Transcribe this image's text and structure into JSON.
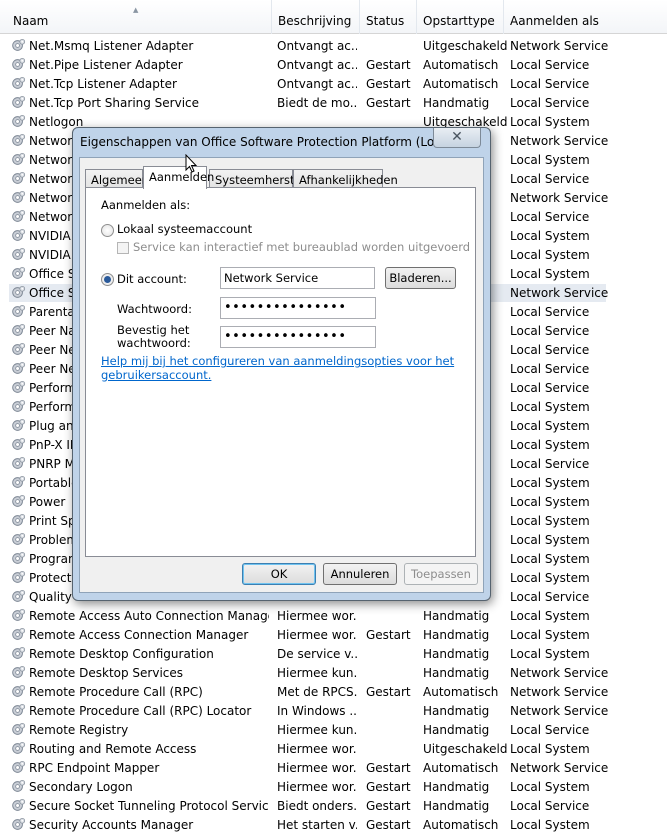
{
  "columns": {
    "name": "Naam",
    "description": "Beschrijving",
    "status": "Status",
    "startup": "Opstarttype",
    "logon": "Aanmelden als"
  },
  "services": [
    {
      "name": "Net.Msmq Listener Adapter",
      "desc": "Ontvangt ac...",
      "status": "",
      "start": "Uitgeschakeld",
      "logon": "Network Service"
    },
    {
      "name": "Net.Pipe Listener Adapter",
      "desc": "Ontvangt ac...",
      "status": "Gestart",
      "start": "Automatisch",
      "logon": "Local Service"
    },
    {
      "name": "Net.Tcp Listener Adapter",
      "desc": "Ontvangt ac...",
      "status": "Gestart",
      "start": "Automatisch",
      "logon": "Local Service"
    },
    {
      "name": "Net.Tcp Port Sharing Service",
      "desc": "Biedt de mo...",
      "status": "Gestart",
      "start": "Handmatig",
      "logon": "Local Service"
    },
    {
      "name": "Netlogon",
      "desc": "",
      "status": "",
      "start": "Uitgeschakeld",
      "logon": "Local System"
    },
    {
      "name": "Network",
      "desc": "",
      "status": "",
      "start": "",
      "logon": "Network Service"
    },
    {
      "name": "Network",
      "desc": "",
      "status": "",
      "start": "",
      "logon": "Local System"
    },
    {
      "name": "Network",
      "desc": "",
      "status": "",
      "start": "",
      "logon": "Local Service"
    },
    {
      "name": "Network",
      "desc": "",
      "status": "",
      "start": "",
      "logon": "Network Service"
    },
    {
      "name": "Network",
      "desc": "",
      "status": "",
      "start": "",
      "logon": "Local Service"
    },
    {
      "name": "NVIDIA",
      "desc": "",
      "status": "",
      "start": "",
      "logon": "Local System"
    },
    {
      "name": "NVIDIA",
      "desc": "",
      "status": "",
      "start": "",
      "logon": "Local System"
    },
    {
      "name": "Office S",
      "desc": "",
      "status": "",
      "start": "",
      "logon": "Local System"
    },
    {
      "name": "Office S",
      "desc": "",
      "status": "",
      "start": "",
      "logon": "Network Service",
      "selected": true
    },
    {
      "name": "Parental",
      "desc": "",
      "status": "",
      "start": "",
      "logon": "Local Service"
    },
    {
      "name": "Peer Na",
      "desc": "",
      "status": "",
      "start": "",
      "logon": "Local Service"
    },
    {
      "name": "Peer Ne",
      "desc": "",
      "status": "",
      "start": "",
      "logon": "Local Service"
    },
    {
      "name": "Peer Ne",
      "desc": "",
      "status": "",
      "start": "",
      "logon": "Local Service"
    },
    {
      "name": "Perform",
      "desc": "",
      "status": "",
      "start": "",
      "logon": "Local Service"
    },
    {
      "name": "Perform",
      "desc": "",
      "status": "",
      "start": "",
      "logon": "Local System"
    },
    {
      "name": "Plug and",
      "desc": "",
      "status": "",
      "start": "",
      "logon": "Local System"
    },
    {
      "name": "PnP-X IP",
      "desc": "",
      "status": "",
      "start": "",
      "logon": "Local System"
    },
    {
      "name": "PNRP M",
      "desc": "",
      "status": "",
      "start": "",
      "logon": "Local Service"
    },
    {
      "name": "Portable",
      "desc": "",
      "status": "",
      "start": "",
      "logon": "Local System"
    },
    {
      "name": "Power",
      "desc": "",
      "status": "",
      "start": "",
      "logon": "Local System"
    },
    {
      "name": "Print Sp",
      "desc": "",
      "status": "",
      "start": "",
      "logon": "Local System"
    },
    {
      "name": "Problem",
      "desc": "",
      "status": "",
      "start": "",
      "logon": "Local System"
    },
    {
      "name": "Program",
      "desc": "",
      "status": "",
      "start": "",
      "logon": "Local System"
    },
    {
      "name": "Protecte",
      "desc": "",
      "status": "",
      "start": "",
      "logon": "Local System"
    },
    {
      "name": "Quality",
      "desc": "",
      "status": "",
      "start": "",
      "logon": "Local Service"
    },
    {
      "name": "Remote Access Auto Connection Manager",
      "desc": "Hiermee wor...",
      "status": "",
      "start": "Handmatig",
      "logon": "Local System"
    },
    {
      "name": "Remote Access Connection Manager",
      "desc": "Hiermee wor...",
      "status": "Gestart",
      "start": "Handmatig",
      "logon": "Local System"
    },
    {
      "name": "Remote Desktop Configuration",
      "desc": "De service v...",
      "status": "",
      "start": "Handmatig",
      "logon": "Local System"
    },
    {
      "name": "Remote Desktop Services",
      "desc": "Hiermee kun...",
      "status": "",
      "start": "Handmatig",
      "logon": "Network Service"
    },
    {
      "name": "Remote Procedure Call (RPC)",
      "desc": "Met de RPCS...",
      "status": "Gestart",
      "start": "Automatisch",
      "logon": "Network Service"
    },
    {
      "name": "Remote Procedure Call (RPC) Locator",
      "desc": "In Windows ...",
      "status": "",
      "start": "Handmatig",
      "logon": "Network Service"
    },
    {
      "name": "Remote Registry",
      "desc": "Hiermee kun...",
      "status": "",
      "start": "Handmatig",
      "logon": "Local Service"
    },
    {
      "name": "Routing and Remote Access",
      "desc": "Hiermee wor...",
      "status": "",
      "start": "Uitgeschakeld",
      "logon": "Local System"
    },
    {
      "name": "RPC Endpoint Mapper",
      "desc": "Hiermee wor...",
      "status": "Gestart",
      "start": "Automatisch",
      "logon": "Network Service"
    },
    {
      "name": "Secondary Logon",
      "desc": "Hiermee wor...",
      "status": "Gestart",
      "start": "Handmatig",
      "logon": "Local System"
    },
    {
      "name": "Secure Socket Tunneling Protocol Service",
      "desc": "Biedt onders...",
      "status": "Gestart",
      "start": "Handmatig",
      "logon": "Local Service"
    },
    {
      "name": "Security Accounts Manager",
      "desc": "Het starten v...",
      "status": "Gestart",
      "start": "Automatisch",
      "logon": "Local System"
    }
  ],
  "dialog": {
    "title": "Eigenschappen van Office Software Protection Platform (Lokale c...",
    "close_glyph": "✕",
    "tabs": [
      "Algemeen",
      "Aanmelden",
      "Systeemherstel",
      "Afhankelijkheden"
    ],
    "active_tab": 1,
    "logon_as_label": "Aanmelden als:",
    "local_account_label": "Lokaal systeemaccount",
    "interact_desktop_label": "Service kan interactief met bureaublad worden uitgevoerd",
    "this_account_label": "Dit account:",
    "account_value": "Network Service",
    "browse_label": "Bladeren...",
    "password_label": "Wachtwoord:",
    "password_value": "•••••••••••••••",
    "confirm_label_1": "Bevestig het",
    "confirm_label_2": "wachtwoord:",
    "confirm_value": "•••••••••••••••",
    "help_link_1": "Help mij bij het configureren van aanmeldingsopties voor het",
    "help_link_2": "gebruikersaccount.",
    "ok_label": "OK",
    "cancel_label": "Annuleren",
    "apply_label": "Toepassen"
  }
}
